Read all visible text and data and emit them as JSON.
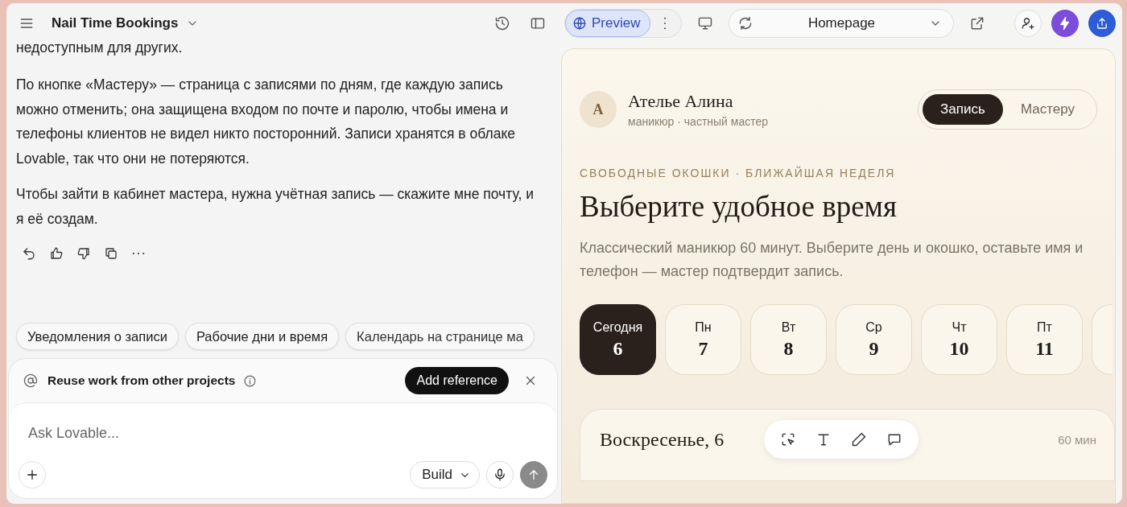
{
  "project": {
    "title": "Nail Time Bookings"
  },
  "chat": {
    "messages": [
      "недоступным для других.",
      "По кнопке «Мастеру» — страница с записями по дням, где каждую запись можно отменить; она защищена входом по почте и паролю, чтобы имена и телефоны клиентов не видел никто посторонний. Записи хранятся в облаке Lovable, так что они не потеряются.",
      "Чтобы зайти в кабинет мастера, нужна учётная запись — скажите мне почту, и я её создам."
    ],
    "suggestions": [
      "Уведомления о записи",
      "Рабочие дни и время",
      "Календарь на странице ма"
    ],
    "reference": {
      "label": "Reuse work from other projects",
      "button": "Add reference"
    },
    "input": {
      "placeholder": "Ask Lovable...",
      "mode": "Build"
    }
  },
  "toolbar": {
    "tabs": [
      {
        "label": "Preview",
        "selected": true
      }
    ],
    "page": "Homepage"
  },
  "preview": {
    "avatar": "А",
    "studio": "Ателье Алина",
    "subtitle": "маникюр · частный мастер",
    "nav": [
      {
        "label": "Запись",
        "selected": true
      },
      {
        "label": "Мастеру",
        "selected": false
      }
    ],
    "eyebrow": "СВОБОДНЫЕ ОКОШКИ · БЛИЖАЙШАЯ НЕДЕЛЯ",
    "heading": "Выберите удобное время",
    "description": "Классический маникюр 60 минут. Выберите день и окошко, оставьте имя и телефон — мастер подтвердит запись.",
    "days": [
      {
        "weekday": "Сегодня",
        "date": "6",
        "selected": true
      },
      {
        "weekday": "Пн",
        "date": "7",
        "selected": false
      },
      {
        "weekday": "Вт",
        "date": "8",
        "selected": false
      },
      {
        "weekday": "Ср",
        "date": "9",
        "selected": false
      },
      {
        "weekday": "Чт",
        "date": "10",
        "selected": false
      },
      {
        "weekday": "Пт",
        "date": "11",
        "selected": false
      }
    ],
    "slot_card": {
      "title": "Воскресенье, 6",
      "duration": "60 мин"
    }
  }
}
